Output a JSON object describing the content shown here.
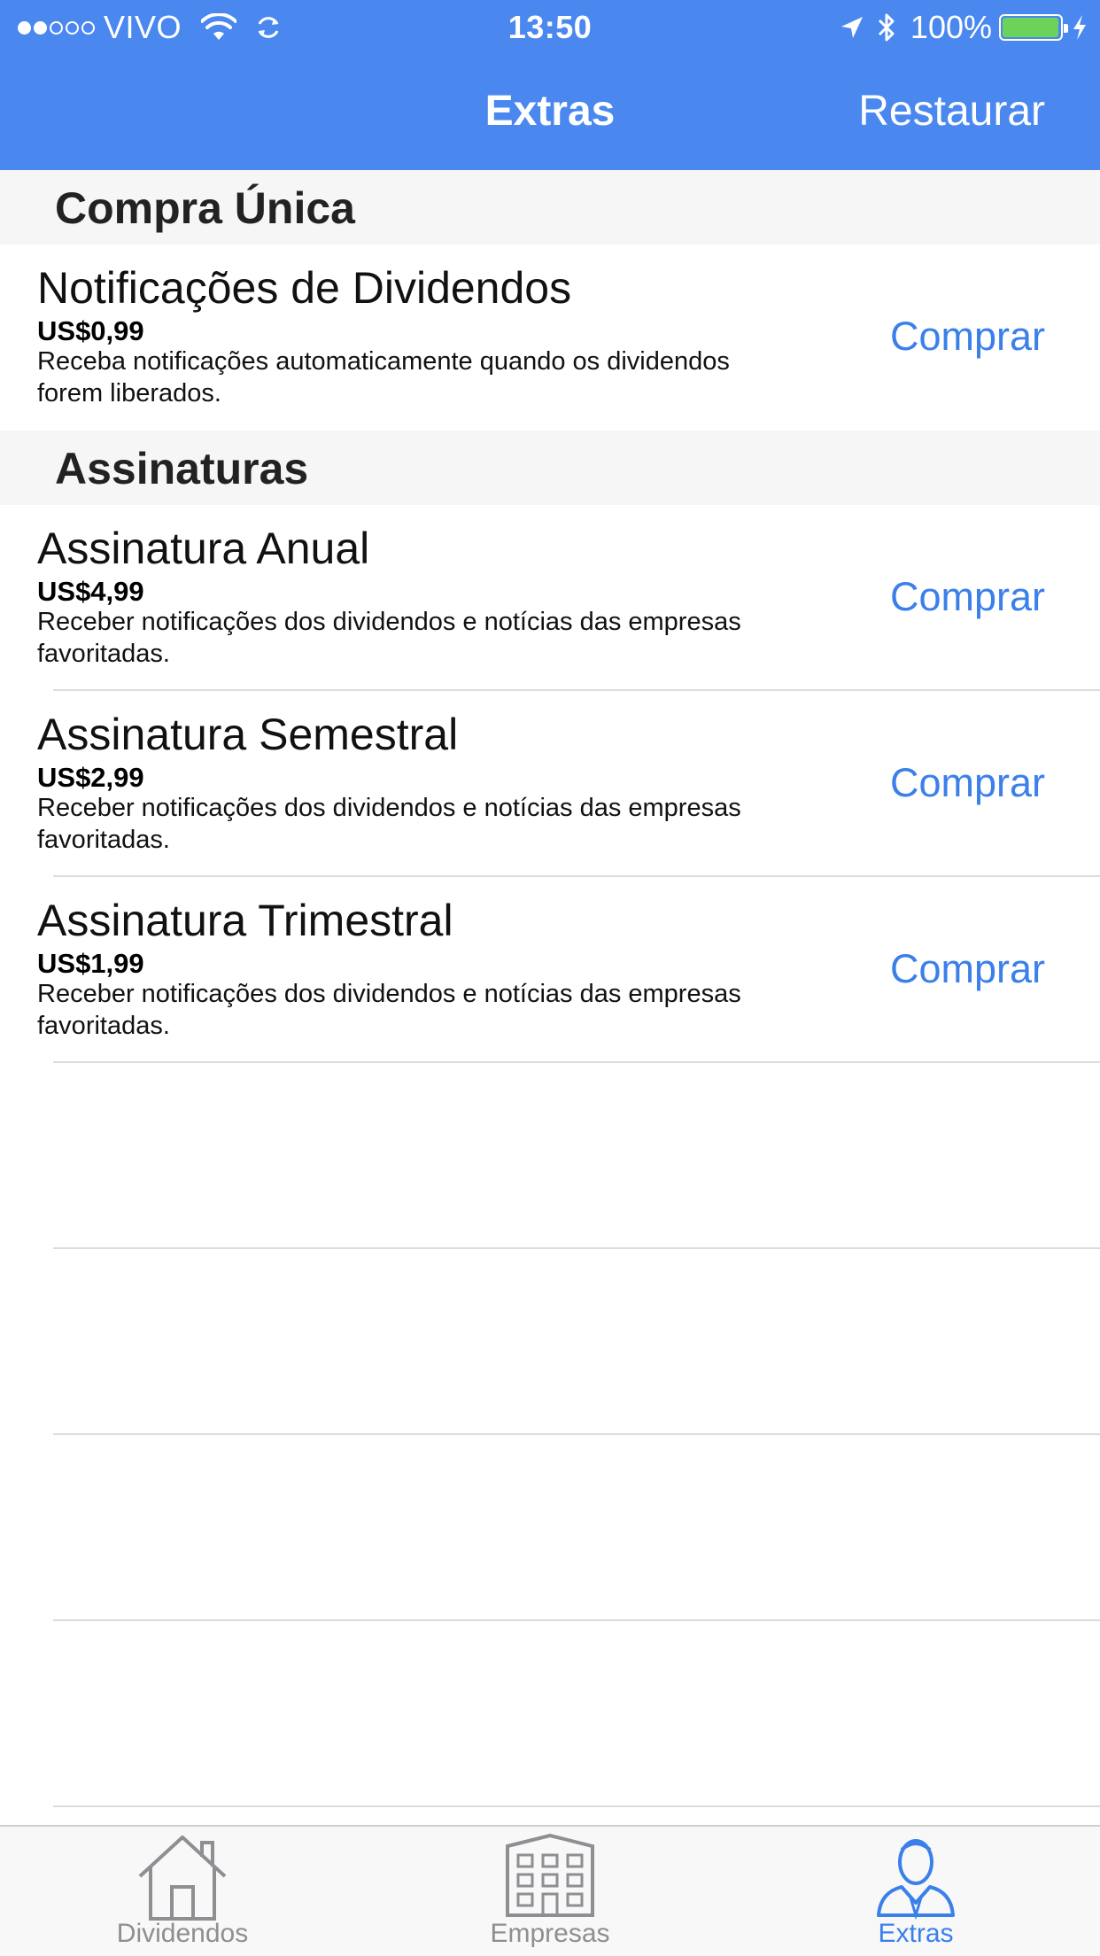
{
  "status_bar": {
    "carrier": "VIVO",
    "time": "13:50",
    "battery_percent": "100%",
    "battery_level": 0.92,
    "signal_bars_filled": 2,
    "signal_bars_total": 5
  },
  "nav": {
    "title": "Extras",
    "restore_label": "Restaurar"
  },
  "sections": [
    {
      "title": "Compra Única",
      "items": [
        {
          "title": "Notificações de Dividendos",
          "price": "US$0,99",
          "description": "Receba notificações automaticamente quando os dividendos forem liberados.",
          "buy_label": "Comprar"
        }
      ]
    },
    {
      "title": "Assinaturas",
      "items": [
        {
          "title": "Assinatura Anual",
          "price": "US$4,99",
          "description": "Receber notificações dos dividendos e notícias das empresas favoritadas.",
          "buy_label": "Comprar"
        },
        {
          "title": "Assinatura Semestral",
          "price": "US$2,99",
          "description": "Receber notificações dos dividendos e notícias das empresas favoritadas.",
          "buy_label": "Comprar"
        },
        {
          "title": "Assinatura Trimestral",
          "price": "US$1,99",
          "description": "Receber notificações dos dividendos e notícias das empresas favoritadas.",
          "buy_label": "Comprar"
        }
      ]
    }
  ],
  "tab_bar": {
    "tabs": [
      {
        "label": "Dividendos",
        "icon": "house-icon",
        "active": false
      },
      {
        "label": "Empresas",
        "icon": "building-icon",
        "active": false
      },
      {
        "label": "Extras",
        "icon": "person-icon",
        "active": true
      }
    ]
  },
  "colors": {
    "nav_background": "#4a88f0",
    "accent": "#3b80ea",
    "inactive_tab": "#8e8e93",
    "battery_green": "#6bd35c",
    "section_background": "#f6f6f6"
  }
}
